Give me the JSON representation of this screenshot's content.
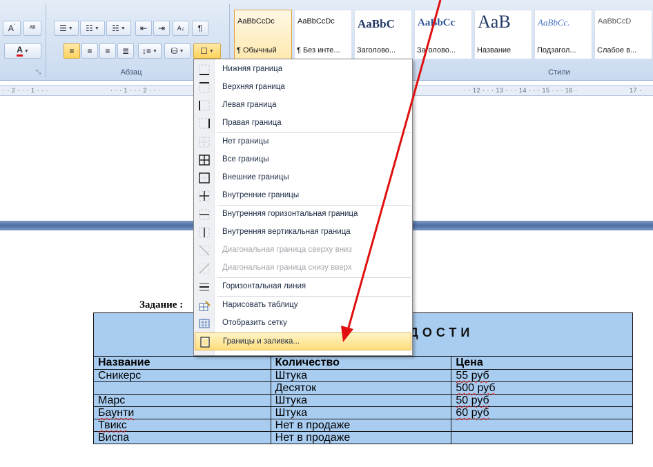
{
  "ribbon": {
    "paragraph_group_label": "Абзац",
    "styles_group_label": "Стили",
    "styles": [
      {
        "sample": "AaBbCcDc",
        "name": "¶ Обычный",
        "selected": true
      },
      {
        "sample": "AaBbCcDc",
        "name": "¶ Без инте...",
        "selected": false
      },
      {
        "sample": "AaBbC",
        "name": "Заголово...",
        "selected": false
      },
      {
        "sample": "AaBbCc",
        "name": "Заголово...",
        "selected": false
      },
      {
        "sample": "AaB",
        "name": "Название",
        "selected": false
      },
      {
        "sample": "AaBbCc.",
        "name": "Подзагол...",
        "selected": false
      },
      {
        "sample": "AaBbCcD",
        "name": "Слабое в...",
        "selected": false
      }
    ]
  },
  "ruler": {
    "left_text": "· · 2 · · · 1 · · ·",
    "mid_text": "· · · 1 · · · 2 · · ·",
    "right_text": "· · 12 · · · 13 · · · 14 · · · 15 · · · 16 ·",
    "right_tail": "17 ·"
  },
  "menu": {
    "items": [
      {
        "label": "Нижняя граница",
        "icon": "border-bottom-icon",
        "disabled": false
      },
      {
        "label": "Верхняя граница",
        "icon": "border-top-icon",
        "disabled": false
      },
      {
        "label": "Левая граница",
        "icon": "border-left-icon",
        "disabled": false
      },
      {
        "label": "Правая граница",
        "icon": "border-right-icon",
        "disabled": false
      },
      {
        "label": "Нет границы",
        "icon": "no-border-icon",
        "disabled": false
      },
      {
        "label": "Все границы",
        "icon": "all-borders-icon",
        "disabled": false
      },
      {
        "label": "Внешние границы",
        "icon": "outside-borders-icon",
        "disabled": false
      },
      {
        "label": "Внутренние границы",
        "icon": "inside-borders-icon",
        "disabled": false
      },
      {
        "label": "Внутренняя горизонтальная граница",
        "icon": "inside-horizontal-border-icon",
        "disabled": false
      },
      {
        "label": "Внутренняя вертикальная граница",
        "icon": "inside-vertical-border-icon",
        "disabled": false
      },
      {
        "label": "Диагональная граница сверху вниз",
        "icon": "diagonal-down-border-icon",
        "disabled": true
      },
      {
        "label": "Диагональная граница снизу вверх",
        "icon": "diagonal-up-border-icon",
        "disabled": true
      },
      {
        "label": "Горизонтальная линия",
        "icon": "horizontal-line-icon",
        "disabled": false
      },
      {
        "label": "Нарисовать таблицу",
        "icon": "draw-table-icon",
        "disabled": false
      },
      {
        "label": "Отобразить сетку",
        "icon": "view-gridlines-icon",
        "disabled": false
      },
      {
        "label": "Границы и заливка...",
        "icon": "borders-and-shading-icon",
        "disabled": false,
        "active": true
      }
    ]
  },
  "document": {
    "task_title": "Задание :",
    "table_header_fragment": "ДОСТИ",
    "columns": [
      "Название",
      "Количество",
      "Цена"
    ],
    "rows": [
      [
        "Сникерс",
        "Штука",
        "55 руб"
      ],
      [
        "",
        "Десяток",
        "500 руб"
      ],
      [
        "Марс",
        "Штука",
        "50 руб"
      ],
      [
        "Баунти",
        "Штука",
        "60 руб"
      ],
      [
        "Твикс",
        "Нет в продаже",
        ""
      ],
      [
        "Виспа",
        "Нет в продаже",
        ""
      ]
    ]
  },
  "colors": {
    "table_fill": "#a9cdf0",
    "menu_highlight": "#ffdd7c",
    "annotation_arrow": "#e01010"
  }
}
